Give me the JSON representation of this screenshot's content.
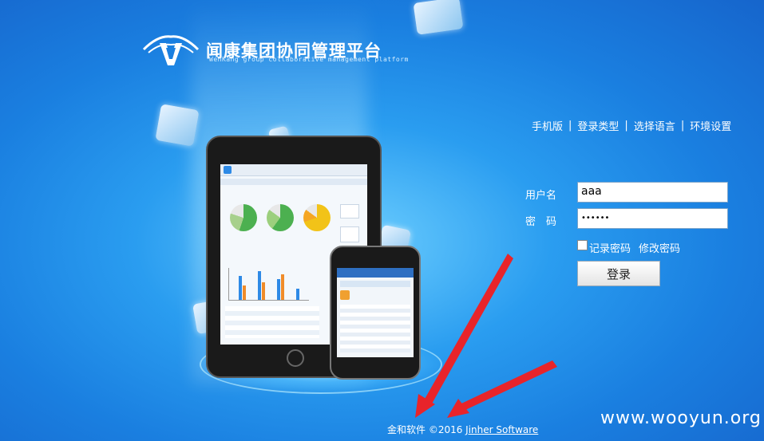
{
  "header": {
    "title": "闻康集团协同管理平台",
    "subtitle": "WenKang group collaborative management platform"
  },
  "toplinks": [
    {
      "label": "手机版"
    },
    {
      "label": "登录类型"
    },
    {
      "label": "选择语言"
    },
    {
      "label": "环境设置"
    }
  ],
  "toplinks_separator": "|",
  "login": {
    "username_label": "用户名",
    "username_value": "aaa",
    "password_label": "密　码",
    "password_value": "••••••",
    "remember_label": "记录密码",
    "modify_label": "修改密码",
    "submit_label": "登录"
  },
  "footer": {
    "copyright": "金和软件 ©2016 ",
    "link": "Jinher Software"
  },
  "watermark": "www.wooyun.org",
  "colors": {
    "background": "#1a7fe0",
    "arrow": "#e8242a"
  }
}
